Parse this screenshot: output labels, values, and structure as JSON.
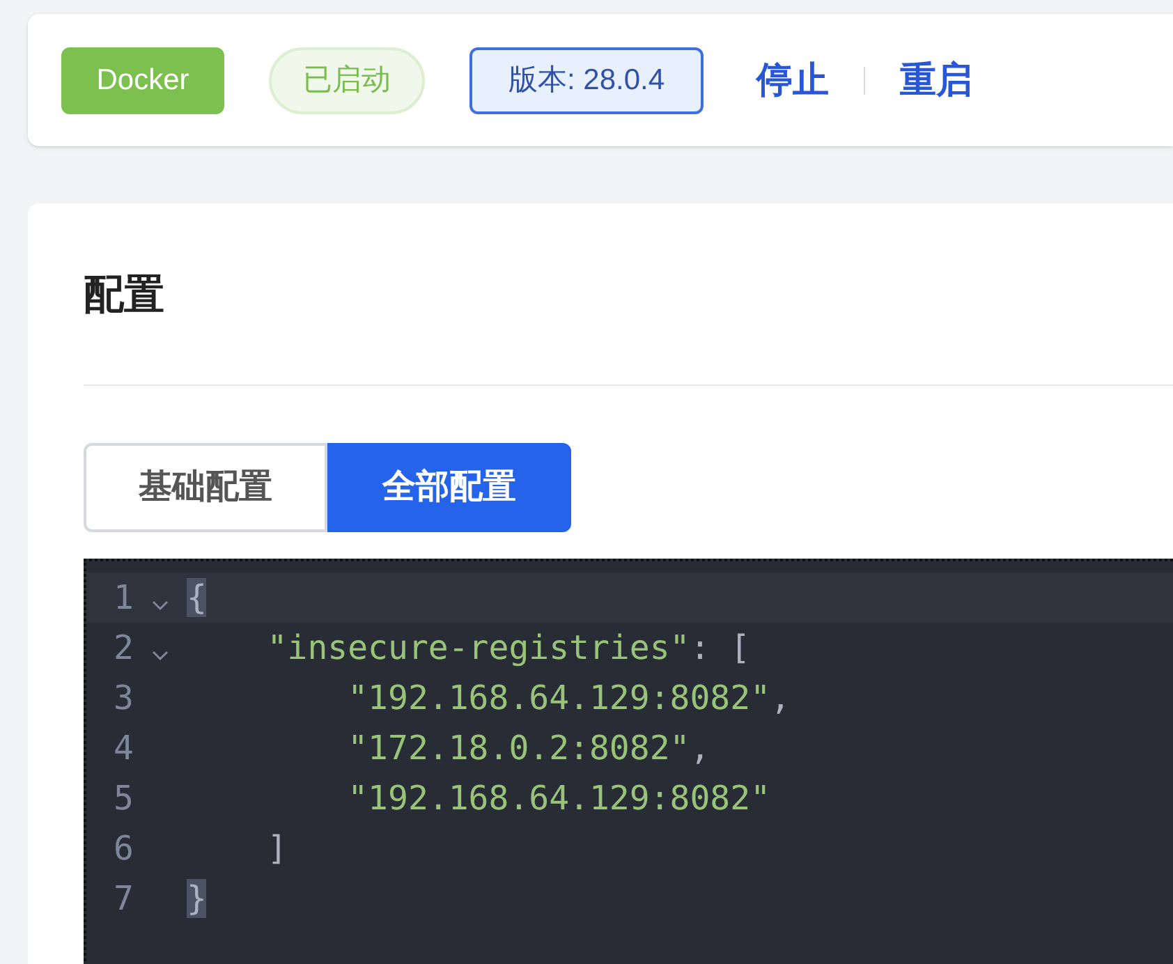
{
  "header": {
    "app_badge": "Docker",
    "status": "已启动",
    "version": "版本: 28.0.4",
    "actions": [
      {
        "label": "停止"
      },
      {
        "label": "重启"
      }
    ]
  },
  "config": {
    "title": "配置",
    "tabs": [
      {
        "label": "基础配置",
        "selected": false
      },
      {
        "label": "全部配置",
        "selected": true
      }
    ],
    "editor": {
      "lines": [
        {
          "number": "1",
          "foldable": true,
          "active": true,
          "tokens": [
            {
              "kind": "match",
              "text": "{"
            }
          ]
        },
        {
          "number": "2",
          "foldable": true,
          "active": false,
          "tokens": [
            {
              "kind": "string",
              "text": "    \"insecure-registries\""
            },
            {
              "kind": "punct",
              "text": ": ["
            }
          ]
        },
        {
          "number": "3",
          "foldable": false,
          "active": false,
          "tokens": [
            {
              "kind": "string",
              "text": "        \"192.168.64.129:8082\""
            },
            {
              "kind": "punct",
              "text": ","
            }
          ]
        },
        {
          "number": "4",
          "foldable": false,
          "active": false,
          "tokens": [
            {
              "kind": "string",
              "text": "        \"172.18.0.2:8082\""
            },
            {
              "kind": "punct",
              "text": ","
            }
          ]
        },
        {
          "number": "5",
          "foldable": false,
          "active": false,
          "tokens": [
            {
              "kind": "string",
              "text": "        \"192.168.64.129:8082\""
            }
          ]
        },
        {
          "number": "6",
          "foldable": false,
          "active": false,
          "tokens": [
            {
              "kind": "punct",
              "text": "    ]"
            }
          ]
        },
        {
          "number": "7",
          "foldable": false,
          "active": false,
          "tokens": [
            {
              "kind": "match",
              "text": "}"
            }
          ]
        }
      ]
    }
  }
}
